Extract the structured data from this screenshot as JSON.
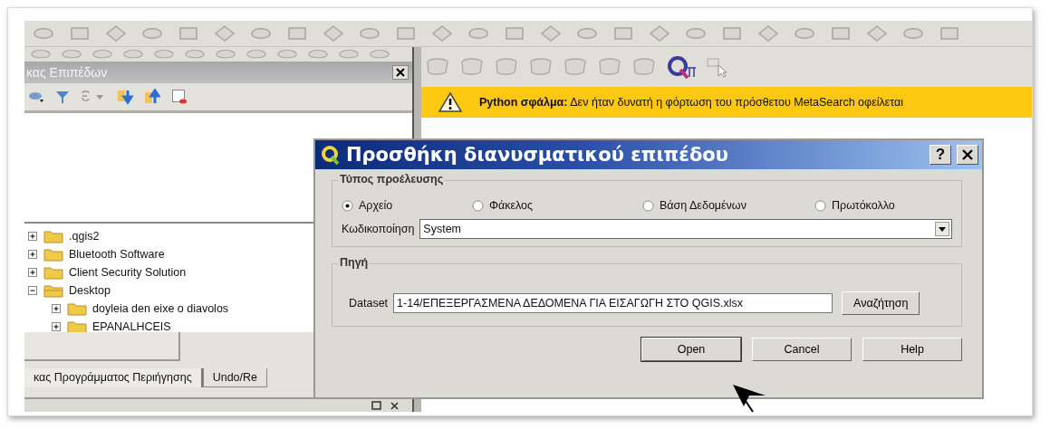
{
  "layers_panel": {
    "title": "κας Επιπέδων"
  },
  "message_bar": {
    "text": "**Python σφάλμα:** Δεν ήταν δυνατή η φόρτωση του πρόσθετου MetaSearch οφείλεται"
  },
  "browser_tree": [
    {
      "label": ".qgis2",
      "expanded": false
    },
    {
      "label": "Bluetooth Software",
      "expanded": false
    },
    {
      "label": "Client Security Solution",
      "expanded": false
    },
    {
      "label": "Desktop",
      "expanded": true,
      "children": [
        {
          "label": "doyleia den eixe o diavolos",
          "expanded": false
        },
        {
          "label": "EPANALHCEIS",
          "expanded": false
        }
      ]
    }
  ],
  "bottom_tabs": [
    {
      "label": "κας Προγράμματος Περιήγησης",
      "selected": true
    },
    {
      "label": "Undo/Re",
      "selected": false
    }
  ],
  "dialog": {
    "title": "Προσθήκη διανυσματικού επιπέδου",
    "help_button": "?",
    "source_type": {
      "title": "Τύπος προέλευσης",
      "options": [
        {
          "label": "Αρχείο",
          "selected": true
        },
        {
          "label": "Φάκελος",
          "selected": false
        },
        {
          "label": "Βάση Δεδομένων",
          "selected": false
        },
        {
          "label": "Πρωτόκολλο",
          "selected": false
        }
      ]
    },
    "encoding": {
      "label": "Κωδικοποίηση",
      "value": "System"
    },
    "source": {
      "title": "Πηγή",
      "dataset_label": "Dataset",
      "dataset_value": "1-14/ΕΠΕΞΕΡΓΑΣΜΕΝΑ ΔΕΔΟΜΕΝΑ ΓΙΑ ΕΙΣΑΓΩΓΗ ΣΤΟ QGIS.xlsx",
      "browse_button": "Αναζήτηση"
    },
    "buttons": [
      "Open",
      "Cancel",
      "Help"
    ]
  }
}
